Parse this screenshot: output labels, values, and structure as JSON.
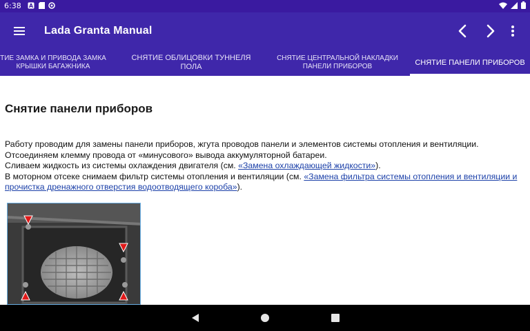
{
  "status_bar": {
    "time": "6:38",
    "left_icons": [
      "a-notification-icon",
      "sd-card-icon",
      "sync-icon"
    ],
    "right_icons": [
      "wifi-icon",
      "signal-icon",
      "battery-icon"
    ]
  },
  "app_bar": {
    "title": "Lada Granta Manual",
    "menu_icon": "hamburger-menu-icon",
    "back_icon": "chevron-left-icon",
    "forward_icon": "chevron-right-icon",
    "overflow_icon": "more-vertical-icon"
  },
  "tabs": [
    {
      "line1": "ТИЕ ЗАМКА И ПРИВОДА ЗАМКА",
      "line2": "КРЫШКИ БАГАЖНИКА",
      "active": false
    },
    {
      "line1": "СНЯТИЕ ОБЛИЦОВКИ ТУННЕЛЯ",
      "line2": "ПОЛА",
      "active": false
    },
    {
      "line1": "СНЯТИЕ ЦЕНТРАЛЬНОЙ НАКЛАДКИ",
      "line2": "ПАНЕЛИ ПРИБОРОВ",
      "active": false
    },
    {
      "line1": "СНЯТИЕ ПАНЕЛИ ПРИБОРОВ",
      "line2": "",
      "active": true
    }
  ],
  "article": {
    "heading": "Снятие панели приборов",
    "line1": "Работу проводим для замены панели приборов, жгута проводов панели и элементов системы отопления и вентиляции.",
    "line2": "Отсоединяем клемму провода от «минусового» вывода аккумуляторной батареи.",
    "line3_prefix": "Сливаем жидкость из системы охлаждения двигателя (см. ",
    "line3_link": "«Замена охлаждающей жидкости»",
    "line3_suffix": ").",
    "line4_prefix": "В моторном отсеке снимаем фильтр системы отопления и вентиляции (см. ",
    "line4_link": "«Замена фильтра системы отопления и вентиляции и прочистка дренажного отверстия водоотводящего короба»",
    "line4_suffix": ")."
  },
  "nav_bar": {
    "back": "triangle-back-icon",
    "home": "circle-home-icon",
    "recents": "square-recents-icon"
  },
  "colors": {
    "status_bar": "#3a1aa0",
    "app_bar": "#3f27aa",
    "link": "#1a3fa8",
    "nav_bar": "#000000"
  }
}
